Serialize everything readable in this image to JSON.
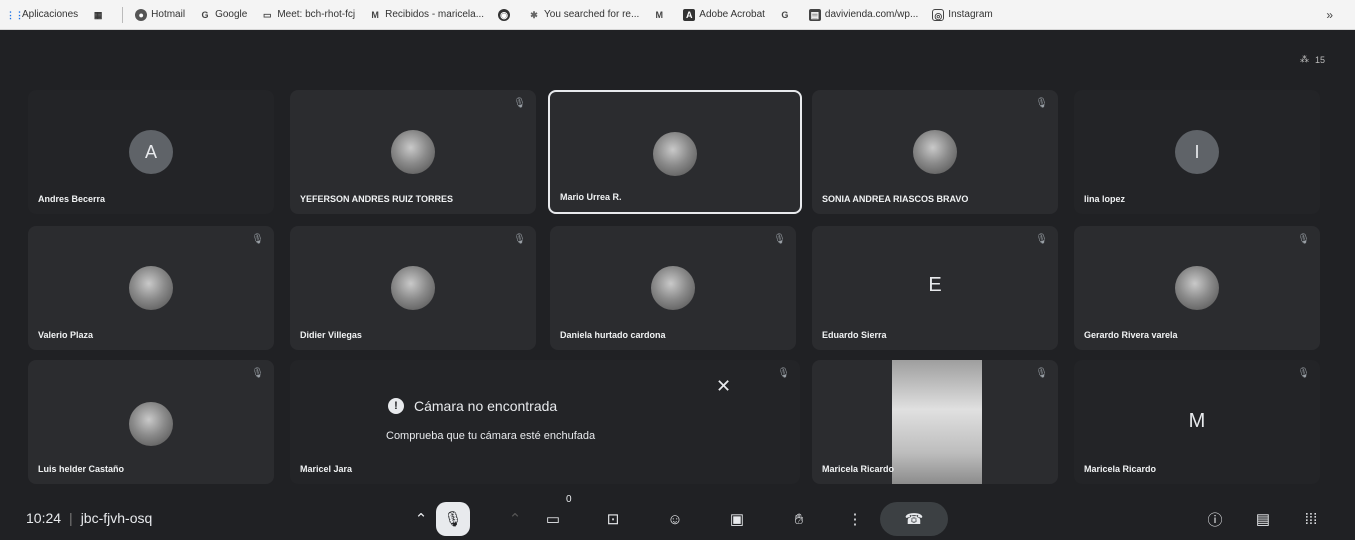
{
  "bookmarks": [
    {
      "label": "Aplicaciones",
      "icon": "apps-grid-icon"
    },
    {
      "label": "",
      "icon": "grid-icon"
    },
    {
      "label": "Hotmail",
      "icon": "hotmail-icon"
    },
    {
      "label": "Google",
      "icon": "google-icon"
    },
    {
      "label": "Meet: bch-rhot-fcj",
      "icon": "meet-icon"
    },
    {
      "label": "Recibidos - maricela...",
      "icon": "gmail-icon"
    },
    {
      "label": "",
      "icon": "globe-icon"
    },
    {
      "label": "You searched for re...",
      "icon": "search-result-icon"
    },
    {
      "label": "",
      "icon": "gmail-icon"
    },
    {
      "label": "Adobe Acrobat",
      "icon": "acrobat-icon"
    },
    {
      "label": "",
      "icon": "google-icon"
    },
    {
      "label": "davivienda.com/wp...",
      "icon": "davivienda-icon"
    },
    {
      "label": "Instagram",
      "icon": "instagram-icon"
    }
  ],
  "bookmarks_more": "»",
  "people_count": "15",
  "participants": [
    {
      "name": "Andres Becerra",
      "avatar": "A"
    },
    {
      "name": "YEFERSON ANDRES RUIZ TORRES",
      "avatar": ""
    },
    {
      "name": "Mario Urrea R.",
      "avatar": ""
    },
    {
      "name": "SONIA ANDREA RIASCOS BRAVO",
      "avatar": ""
    },
    {
      "name": "lina lopez",
      "avatar": "I"
    },
    {
      "name": "Valerio Plaza",
      "avatar": ""
    },
    {
      "name": "Didier Villegas",
      "avatar": ""
    },
    {
      "name": "Daniela hurtado cardona",
      "avatar": ""
    },
    {
      "name": "Eduardo Sierra",
      "avatar": "E"
    },
    {
      "name": "Gerardo Rivera varela",
      "avatar": ""
    },
    {
      "name": "Luis helder Castaño",
      "avatar": ""
    },
    {
      "name": "Maricel Jara",
      "avatar": ""
    },
    {
      "name": "Maricela Ricardo",
      "avatar": ""
    },
    {
      "name": "Maricela Ricardo",
      "avatar": "M"
    }
  ],
  "toast": {
    "title": "Cámara no encontrada",
    "subtitle": "Comprueba que tu cámara esté enchufada",
    "close": "✕"
  },
  "bottom": {
    "time": "10:24",
    "meeting_code": "jbc-fjvh-osq",
    "camera_badge": "0"
  }
}
